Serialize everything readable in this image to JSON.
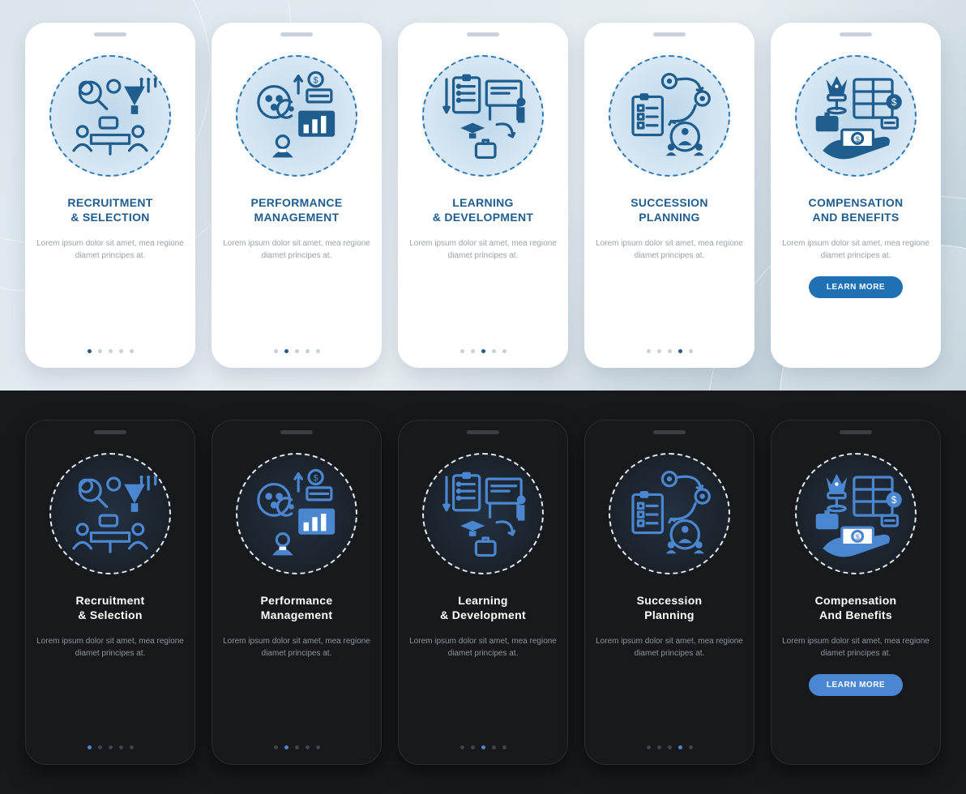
{
  "common": {
    "desc": "Lorem ipsum dolor sit amet, mea regione diamet principes at.",
    "learn_more": "LEARN MORE"
  },
  "light": {
    "screens": [
      {
        "title_l1": "RECRUITMENT",
        "title_l2": "& SELECTION",
        "active_dot": 0,
        "icon": "recruitment"
      },
      {
        "title_l1": "PERFORMANCE",
        "title_l2": "MANAGEMENT",
        "active_dot": 1,
        "icon": "performance"
      },
      {
        "title_l1": "LEARNING",
        "title_l2": "& DEVELOPMENT",
        "active_dot": 2,
        "icon": "learning"
      },
      {
        "title_l1": "SUCCESSION",
        "title_l2": "PLANNING",
        "active_dot": 3,
        "icon": "succession"
      },
      {
        "title_l1": "COMPENSATION",
        "title_l2": "AND BENEFITS",
        "active_dot": 4,
        "icon": "compensation",
        "has_button": true
      }
    ],
    "dot_count": 5
  },
  "dark": {
    "screens": [
      {
        "title_l1": "Recruitment",
        "title_l2": "& Selection",
        "active_dot": 0,
        "icon": "recruitment"
      },
      {
        "title_l1": "Performance",
        "title_l2": "Management",
        "active_dot": 1,
        "icon": "performance"
      },
      {
        "title_l1": "Learning",
        "title_l2": "& Development",
        "active_dot": 2,
        "icon": "learning"
      },
      {
        "title_l1": "Succession",
        "title_l2": "Planning",
        "active_dot": 3,
        "icon": "succession"
      },
      {
        "title_l1": "Compensation",
        "title_l2": "And Benefits",
        "active_dot": 4,
        "icon": "compensation",
        "has_button": true
      }
    ],
    "dot_count": 5
  },
  "colors": {
    "accent_light": "#1f5d8f",
    "accent_dark": "#4b86d1"
  }
}
